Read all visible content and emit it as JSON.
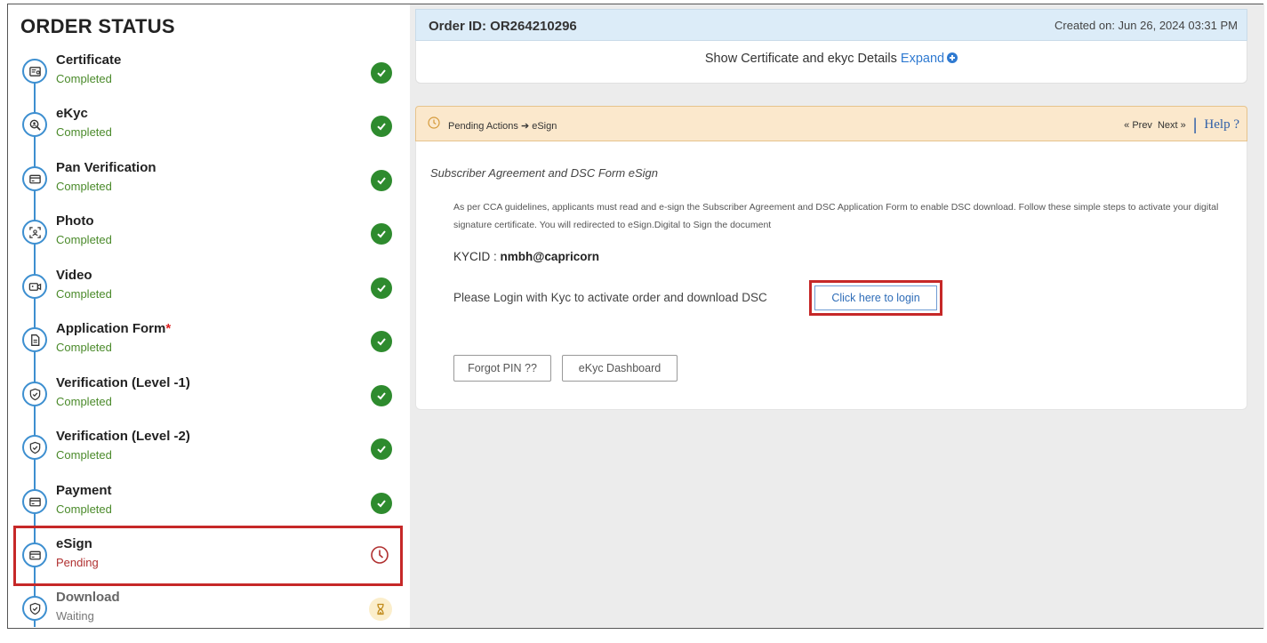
{
  "sidebar": {
    "title": "ORDER STATUS",
    "steps": [
      {
        "label": "Certificate",
        "status": "Completed",
        "icon": "certificate-icon"
      },
      {
        "label": "eKyc",
        "status": "Completed",
        "icon": "search-person-icon"
      },
      {
        "label": "Pan Verification",
        "status": "Completed",
        "icon": "card-icon"
      },
      {
        "label": "Photo",
        "status": "Completed",
        "icon": "photo-icon"
      },
      {
        "label": "Video",
        "status": "Completed",
        "icon": "video-icon"
      },
      {
        "label": "Application Form",
        "required_mark": "*",
        "status": "Completed",
        "icon": "document-icon"
      },
      {
        "label": "Verification (Level -1)",
        "status": "Completed",
        "icon": "shield-check-icon"
      },
      {
        "label": "Verification (Level -2)",
        "status": "Completed",
        "icon": "shield-check-icon"
      },
      {
        "label": "Payment",
        "status": "Completed",
        "icon": "card-icon"
      },
      {
        "label": "eSign",
        "status": "Pending",
        "icon": "card-icon"
      },
      {
        "label": "Download",
        "status": "Waiting",
        "icon": "shield-check-icon"
      }
    ]
  },
  "header": {
    "order_id": "Order ID: OR264210296",
    "created_on": "Created on: Jun 26, 2024 03:31 PM",
    "details_text": "Show Certificate and ekyc Details",
    "expand_label": "Expand"
  },
  "pending": {
    "breadcrumb_text": "Pending Actions ➔ eSign",
    "prev_label": "« Prev",
    "next_label": "Next »",
    "separator": "|",
    "help_label": "Help ?"
  },
  "panel": {
    "title": "Subscriber Agreement and DSC Form eSign",
    "description": "As per CCA guidelines, applicants must read and e-sign the Subscriber Agreement and DSC Application Form to enable DSC download. Follow these simple steps to activate your digital signature certificate. You will redirected to eSign.Digital to Sign the document",
    "kycid_label": "KYCID : ",
    "kycid_value": "nmbh@capricorn",
    "login_prompt": "Please Login with Kyc to activate order and download DSC",
    "login_button": "Click here to login",
    "forgot_button": "Forgot PIN ??",
    "dashboard_button": "eKyc Dashboard"
  },
  "colors": {
    "timeline": "#3d8fd0",
    "completed_check": "#2e8b2e",
    "pending_text": "#b03030",
    "highlight_border": "#c62828",
    "pending_bar_bg": "#fbe8cc",
    "header_bg": "#dcecf8"
  }
}
